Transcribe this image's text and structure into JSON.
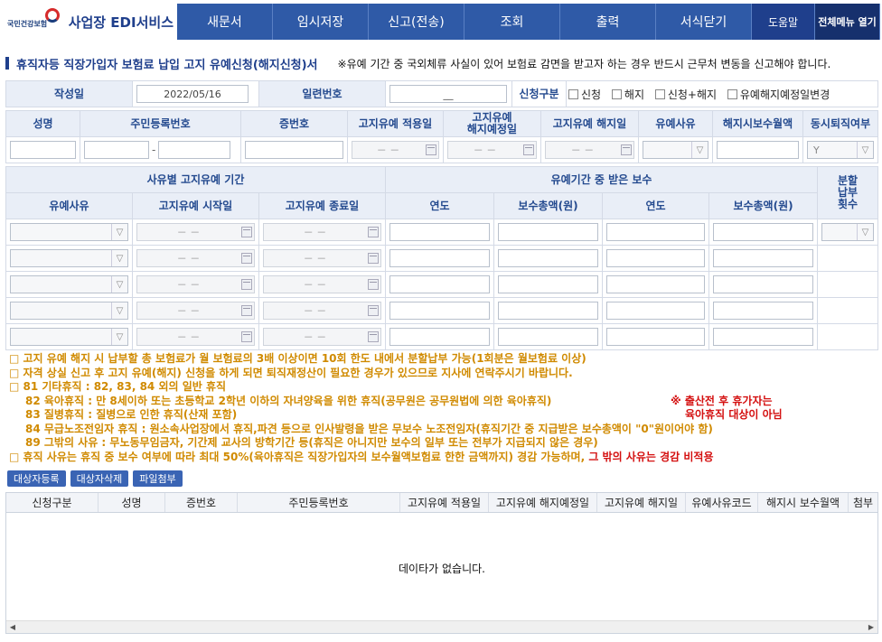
{
  "app": {
    "logo_text": "국민건강보험",
    "brand": "사업장 EDI서비스"
  },
  "menu": [
    {
      "label": "새문서"
    },
    {
      "label": "임시저장"
    },
    {
      "label": "신고(전송)"
    },
    {
      "label": "조회"
    },
    {
      "label": "출력"
    },
    {
      "label": "서식닫기"
    },
    {
      "label": "도움말"
    },
    {
      "label": "전체메뉴 열기"
    }
  ],
  "page": {
    "title": "휴직자등 직장가입자 보험료 납입 고지 유예신청(해지신청)서",
    "notice": "※유예 기간 중 국외체류 사실이 있어 보험료 감면을 받고자 하는 경우 반드시 근무처 변동을 신고해야 합니다."
  },
  "form_header": {
    "date_label": "작성일",
    "date_value": "2022/05/16",
    "serial_label": "일련번호",
    "serial_value": "__",
    "type_label": "신청구분",
    "options": [
      "신청",
      "해지",
      "신청+해지",
      "유예해지예정일변경"
    ]
  },
  "person": {
    "headers": [
      "성명",
      "주민등록번호",
      "증번호",
      "고지유예 적용일",
      "고지유예\n해지예정일",
      "고지유예 해지일",
      "유예사유",
      "해지시보수월액",
      "동시퇴직여부"
    ],
    "date_placeholder": "－ －",
    "retire_value": "Y"
  },
  "reasons": {
    "group1": "사유별 고지유예 기간",
    "group2": "유예기간 중 받은 보수",
    "installments": "분할\n납부\n횟수",
    "headers": [
      "유예사유",
      "고지유예 시작일",
      "고지유예 종료일",
      "연도",
      "보수총액(원)",
      "연도",
      "보수총액(원)"
    ],
    "date_placeholder": "－ －"
  },
  "info": {
    "lines": [
      "□ 고지 유예 해지 시 납부할 총 보험료가 월 보험료의 3배 이상이면 10회 한도 내에서 분할납부 가능(1회분은 월보험료 이상)",
      "□ 자격 상실 신고 후 고지 유예(해지) 신청을 하게 되면 퇴직재정산이 필요한 경우가 있으므로 지사에 연락주시기 바랍니다.",
      "□ 81 기타휴직 : 82, 83, 84 외의 일반 휴직",
      "82 육아휴직 : 만 8세이하 또는 초등학교 2학년 이하의 자녀양육을 위한 휴직(공무원은 공무원법에 의한 육아휴직)",
      "83 질병휴직 : 질병으로 인한 휴직(산재 포함)",
      "84 무급노조전임자 휴직 : 원소속사업장에서 휴직,파견 등으로 인사발령을 받은 무보수 노조전임자(휴직기간 중 지급받은 보수총액이 \"0\"원이어야 함)",
      "89 그밖의 사유 : 무노동무임금자, 기간제 교사의 방학기간 등(휴직은 아니지만 보수의 일부 또는 전부가 지급되지 않은 경우)",
      "□ 휴직 사유는 휴직 중 보수 여부에 따라 최대 50%(육아휴직은 직장가입자의 보수월액보험료 한한 금액까지) 경감 가능하며,"
    ],
    "red_note_1": "※ 출산전 후 휴가자는",
    "red_note_2": "육아휴직 대상이 아님",
    "red_tail": "그 밖의 사유는 경감 비적용"
  },
  "buttons": {
    "add": "대상자등록",
    "delete": "대상자삭제",
    "attach": "파일첨부"
  },
  "grid": {
    "columns": [
      "신청구분",
      "성명",
      "증번호",
      "주민등록번호",
      "고지유예 적용일",
      "고지유예 해지예정일",
      "고지유예 해지일",
      "유예사유코드",
      "해지시 보수월액",
      "첨부"
    ],
    "empty_message": "데이타가 없습니다."
  },
  "colors": {
    "menu_bg": "#2f5aa7",
    "header_bg": "#e9eef7",
    "header_text": "#244a8f",
    "info_text": "#d08a00",
    "red": "#d41010"
  }
}
